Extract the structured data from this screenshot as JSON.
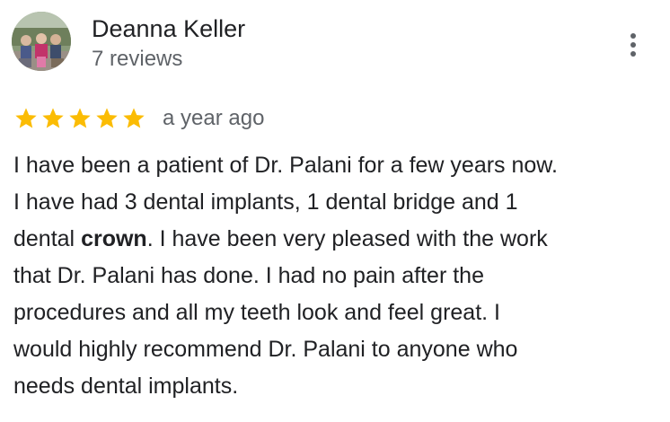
{
  "review": {
    "reviewer_name": "Deanna Keller",
    "review_count": "7 reviews",
    "rating": 5,
    "rating_max": 5,
    "star_color": "#fbbc04",
    "date": "a year ago",
    "text_before": "I have been a patient of Dr. Palani for a few years now.\nI have had 3 dental implants, 1 dental bridge and 1\ndental ",
    "highlight": "crown",
    "text_after": ".  I have been very pleased with the work\nthat Dr. Palani has done.  I had no pain after the\nprocedures and all my teeth look and feel great.  I\nwould highly recommend Dr. Palani to anyone who\nneeds dental implants."
  },
  "icons": {
    "more": "more-vert-icon",
    "star": "star-icon"
  }
}
